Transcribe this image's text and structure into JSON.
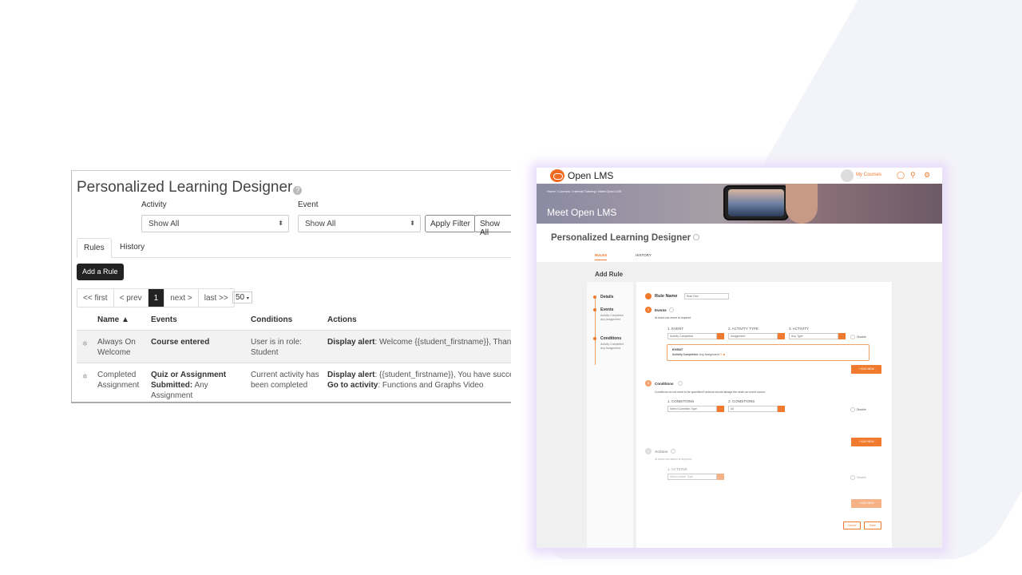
{
  "legacy": {
    "title": "Personalized Learning Designer",
    "help": "?",
    "filters": {
      "activity_label": "Activity",
      "activity_value": "Show All",
      "event_label": "Event",
      "event_value": "Show All",
      "apply_filter": "Apply Filter",
      "show_all": "Show All"
    },
    "tabs": [
      "Rules",
      "History"
    ],
    "add_rule": "Add a Rule",
    "pager": {
      "first": "<< first",
      "prev": "< prev",
      "current": "1",
      "next": "next >",
      "last": "last >>",
      "per_page": "50"
    },
    "columns": {
      "name": "Name ▲",
      "events": "Events",
      "conditions": "Conditions",
      "actions": "Actions"
    },
    "rows": [
      {
        "name_line1": "Always On",
        "name_line2": "Welcome",
        "event": "Course entered",
        "condition_line1": "User is in role:",
        "condition_line2": "Student",
        "action_label": "Display alert",
        "action_text": ": Welcome {{student_firstname}}, Thank y..."
      },
      {
        "name_line1": "Completed",
        "name_line2": "Assignment",
        "event_line1": "Quiz or Assignment",
        "event_label2": "Submitted:",
        "event_text2": " Any",
        "event_line3": "Assignment",
        "condition_line1": "Current activity has",
        "condition_line2": "been completed",
        "action_label": "Display alert",
        "action_text": ": {{student_firstname}}, You have successf...",
        "action2_label": "Go to activity",
        "action2_text": ": Functions and Graphs Video"
      }
    ]
  },
  "openlms": {
    "brand": "Open LMS",
    "my_courses": "My Courses",
    "breadcrumbs": "Home / Courses / Internal Training / Meet Open LMS",
    "hero_title": "Meet Open LMS",
    "page_title": "Personalized Learning Designer",
    "tabs": [
      "RULES",
      "HISTORY"
    ],
    "add_rule_heading": "Add Rule",
    "sidebar": {
      "details": "Details",
      "events": "Events",
      "events_sub1": "Activity Completed",
      "events_sub2": "Any Assignment",
      "conditions": "Conditions",
      "conditions_sub1": "Activity Completed",
      "conditions_sub2": "Any Assignment"
    },
    "rule_name_label": "Rule Name",
    "rule_name_value": "Rule One",
    "events": {
      "title": "Events",
      "note": "At least one event is required",
      "col1": "1. EVENT",
      "col2": "2. ACTIVITY TYPE",
      "col3": "3. ACTIVITY",
      "val1": "Activity Completed",
      "val2": "Assignment",
      "val3": "Any Type",
      "disable": "Disable",
      "box_title": "EVENT",
      "box_label": "Activity Completed:",
      "box_value": "Any Assignment",
      "add_new": "+ ADD NEW"
    },
    "conditions": {
      "title": "Conditions",
      "note": "Conditions do not need to be specified if actions should always fire when an event occurs.",
      "col1": "1. CONDITIONS",
      "col2": "2. CONDITIONS",
      "val1": "Select Condition Type",
      "val2": "All",
      "disable": "Disable",
      "add_new": "+ ADD NEW"
    },
    "actions": {
      "title": "Actions",
      "note": "At least one action is required",
      "col1": "1. ACTIONS",
      "val1": "Select Action Type",
      "disable": "Disable",
      "add_new": "+ ADD NEW"
    },
    "cancel": "Cancel",
    "save": "Save"
  }
}
